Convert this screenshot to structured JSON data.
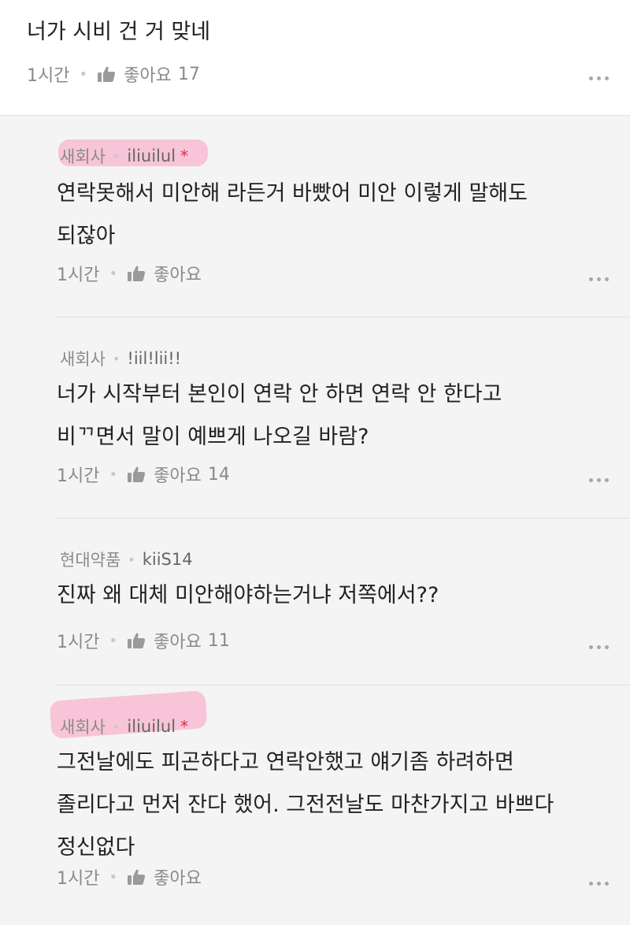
{
  "top_comment": {
    "text": "너가 시비 건 거 맞네",
    "time": "1시간",
    "like_label": "좋아요",
    "like_count": "17"
  },
  "replies": [
    {
      "company": "새회사",
      "nick": "iliuilul",
      "op_mark": "*",
      "text": "연락못해서 미안해 라든거 바빴어 미안 이렇게 말해도\n되잖아",
      "time": "1시간",
      "like_label": "좋아요",
      "like_count": ""
    },
    {
      "company": "새회사",
      "nick": "!iil!lii!!",
      "op_mark": "",
      "text": "너가 시작부터 본인이 연락 안 하면 연락 안 한다고\n비ᄁ면서 말이 예쁘게 나오길 바람?",
      "time": "1시간",
      "like_label": "좋아요",
      "like_count": "14"
    },
    {
      "company": "현대약품",
      "nick": "kiiS14",
      "op_mark": "",
      "text": "진짜 왜 대체 미안해야하는거냐 저쪽에서??",
      "time": "1시간",
      "like_label": "좋아요",
      "like_count": "11"
    },
    {
      "company": "새회사",
      "nick": "iliuilul",
      "op_mark": "*",
      "text": "그전날에도 피곤하다고 연락안했고 얘기좀 하려하면\n졸리다고 먼저 잔다 했어. 그전전날도 마찬가지고 바쁘다\n정신없다",
      "time": "1시간",
      "like_label": "좋아요",
      "like_count": ""
    }
  ],
  "colors": {
    "highlight": "#f8b6ce",
    "op_star": "#d0344a"
  },
  "icons": {
    "like": "thumbs-up-icon",
    "more": "more-dots-icon"
  }
}
